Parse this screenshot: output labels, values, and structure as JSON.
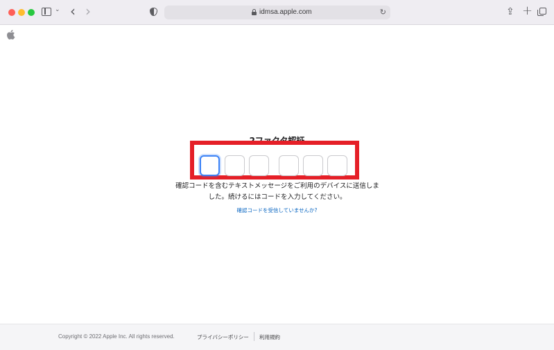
{
  "browser": {
    "url": "idmsa.apple.com",
    "icons": [
      "sidebar-icon",
      "chevron-down-icon",
      "back-arrow-icon",
      "forward-arrow-icon",
      "privacy-shield-icon",
      "lock-icon",
      "reload-icon",
      "share-icon",
      "plus-icon",
      "tabs-overview-icon"
    ],
    "back_glyph": "‹",
    "forward_glyph": "›",
    "chevron_glyph": "⌄",
    "reload_glyph": "↻",
    "share_glyph": "⇪",
    "plus_glyph": "+"
  },
  "page": {
    "logo": "apple-logo-icon",
    "title": "2ファクタ認証",
    "code_digits": [
      "",
      "",
      "",
      "",
      "",
      ""
    ],
    "description_line1": "確認コードを含むテキストメッセージをご利用のデバイスに送信しま",
    "description_line2": "した。続けるにはコードを入力してください。",
    "help_link": "確認コードを受信していませんか?",
    "highlight_color": "#e51f27",
    "focus_color": "#3b82f6",
    "link_color": "#0a66c2"
  },
  "footer": {
    "copyright": "Copyright © 2022 Apple Inc. All rights reserved.",
    "privacy_link": "プライバシーポリシー",
    "terms_link": "利用規約"
  }
}
